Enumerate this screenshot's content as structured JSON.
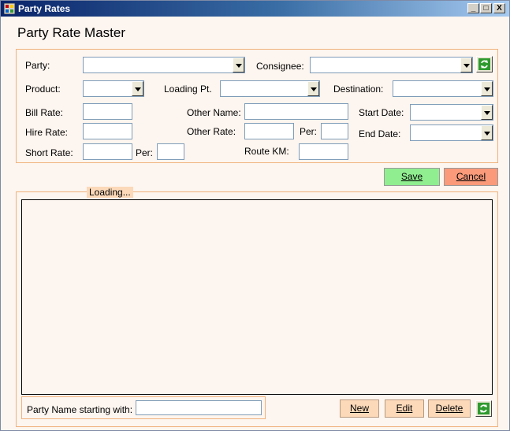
{
  "window": {
    "title": "Party Rates",
    "controls": {
      "minimize": "_",
      "maximize": "□",
      "close": "X"
    }
  },
  "form": {
    "heading": "Party Rate Master",
    "labels": {
      "party": "Party:",
      "consignee": "Consignee:",
      "product": "Product:",
      "loading_pt": "Loading Pt.",
      "destination": "Destination:",
      "bill_rate": "Bill Rate:",
      "other_name": "Other Name:",
      "start_date": "Start Date:",
      "hire_rate": "Hire Rate:",
      "other_rate": "Other Rate:",
      "per": "Per:",
      "end_date": "End Date:",
      "short_rate": "Short Rate:",
      "short_per": "Per:",
      "route_km": "Route KM:"
    },
    "values": {
      "party": "",
      "consignee": "",
      "product": "",
      "loading_pt": "",
      "destination": "",
      "bill_rate": "",
      "other_name": "",
      "start_date": "",
      "hire_rate": "",
      "other_rate": "",
      "per": "",
      "end_date": "",
      "short_rate": "",
      "short_per": "",
      "route_km": ""
    },
    "icons": {
      "refresh": "refresh-icon"
    }
  },
  "actions": {
    "save": "Save",
    "cancel": "Cancel"
  },
  "list": {
    "status": "Loading...",
    "filter_label": "Party Name starting with:",
    "filter_value": "",
    "new": "New",
    "edit": "Edit",
    "delete": "Delete"
  },
  "colors": {
    "background": "#fdf5ef",
    "group_border": "#f0b37f",
    "save": "#90ee90",
    "cancel": "#fa9a7a",
    "button": "#fbd9b9"
  }
}
